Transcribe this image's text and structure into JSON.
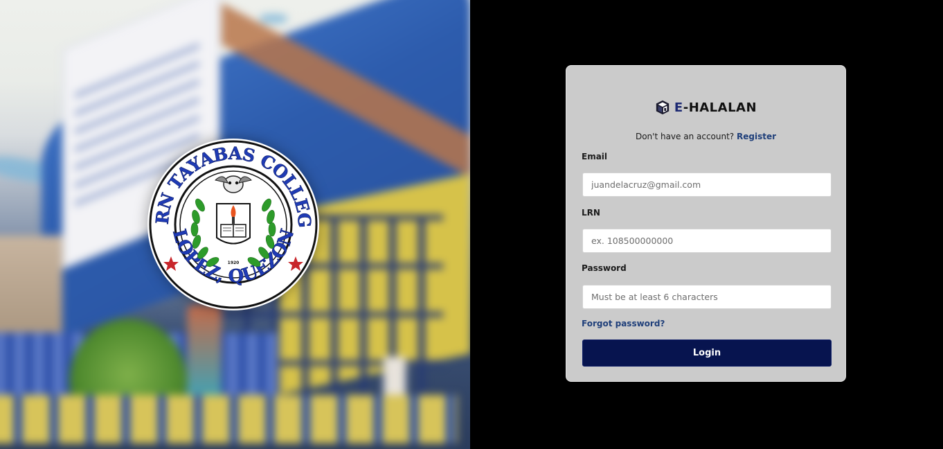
{
  "hero": {
    "seal": {
      "top_text": "EASTERN TAYABAS COLLEGE INC.",
      "bottom_text": "LOPEZ, QUEZON",
      "year": "1920"
    }
  },
  "login": {
    "brand": {
      "prefix": "E",
      "suffix": "-HALALAN",
      "icon": "cube-logo-icon"
    },
    "register_prompt": "Don't have an account?",
    "register_link": "Register",
    "email": {
      "label": "Email",
      "placeholder": "juandelacruz@gmail.com",
      "value": ""
    },
    "lrn": {
      "label": "LRN",
      "placeholder": "ex. 108500000000",
      "value": ""
    },
    "password": {
      "label": "Password",
      "placeholder": "Must be at least 6 characters",
      "value": ""
    },
    "forgot_password": "Forgot password?",
    "login_button": "Login"
  },
  "colors": {
    "card_bg": "#cbcbcb",
    "primary_button": "#07144f",
    "link": "#1f3f7a",
    "right_bg": "#000000"
  }
}
